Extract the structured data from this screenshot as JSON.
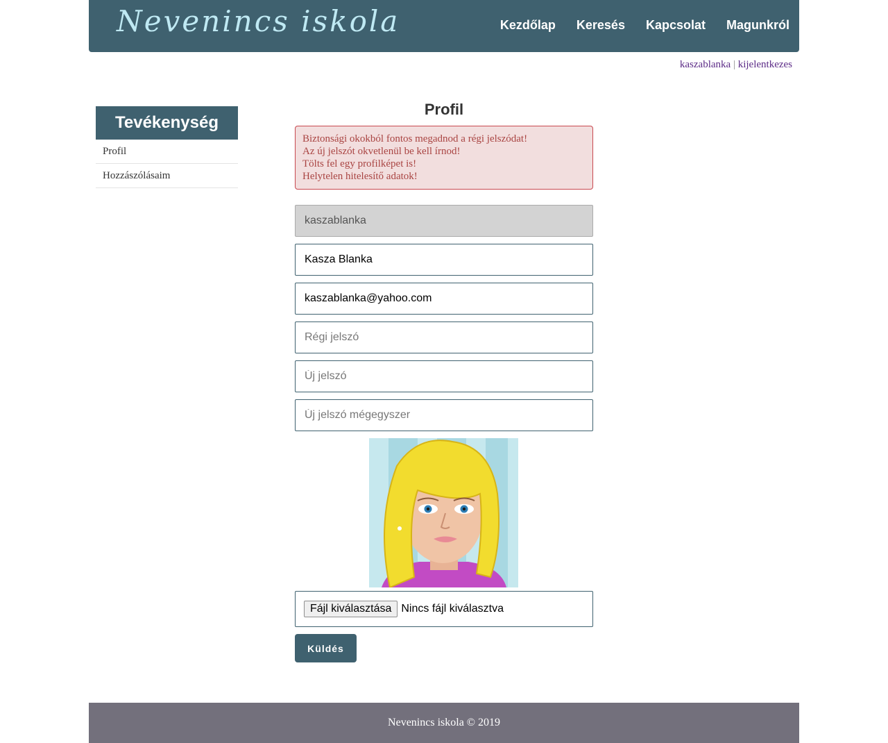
{
  "header": {
    "logo": "Nevenincs iskola",
    "nav": [
      "Kezdőlap",
      "Keresés",
      "Kapcsolat",
      "Magunkról"
    ]
  },
  "userbar": {
    "username": "kaszablanka",
    "separator": "|",
    "logout": "kijelentkezes"
  },
  "sidebar": {
    "title": "Tevékenység",
    "items": [
      "Profil",
      "Hozzászólásaim"
    ]
  },
  "main": {
    "title": "Profil",
    "errors": [
      "Biztonsági okokból fontos megadnod a régi jelszódat!",
      "Az új jelszót okvetlenül be kell írnod!",
      "Tölts fel egy profilképet is!",
      "Helytelen hitelesítő adatok!"
    ],
    "form": {
      "username_value": "kaszablanka",
      "fullname_value": "Kasza Blanka",
      "email_value": "kaszablanka@yahoo.com",
      "old_password_placeholder": "Régi jelszó",
      "new_password_placeholder": "Új jelszó",
      "new_password_again_placeholder": "Új jelszó mégegyszer",
      "file_button": "Fájl kiválasztása",
      "file_status": "Nincs fájl kiválasztva",
      "submit": "Küldés"
    }
  },
  "footer": {
    "text": "Nevenincs iskola © 2019"
  },
  "colors": {
    "brand": "#3f616f",
    "logo": "#bfe9f3",
    "alert_bg": "#f2dede",
    "alert_text": "#a94442",
    "footer": "#73707c",
    "link": "#5b2a86"
  }
}
